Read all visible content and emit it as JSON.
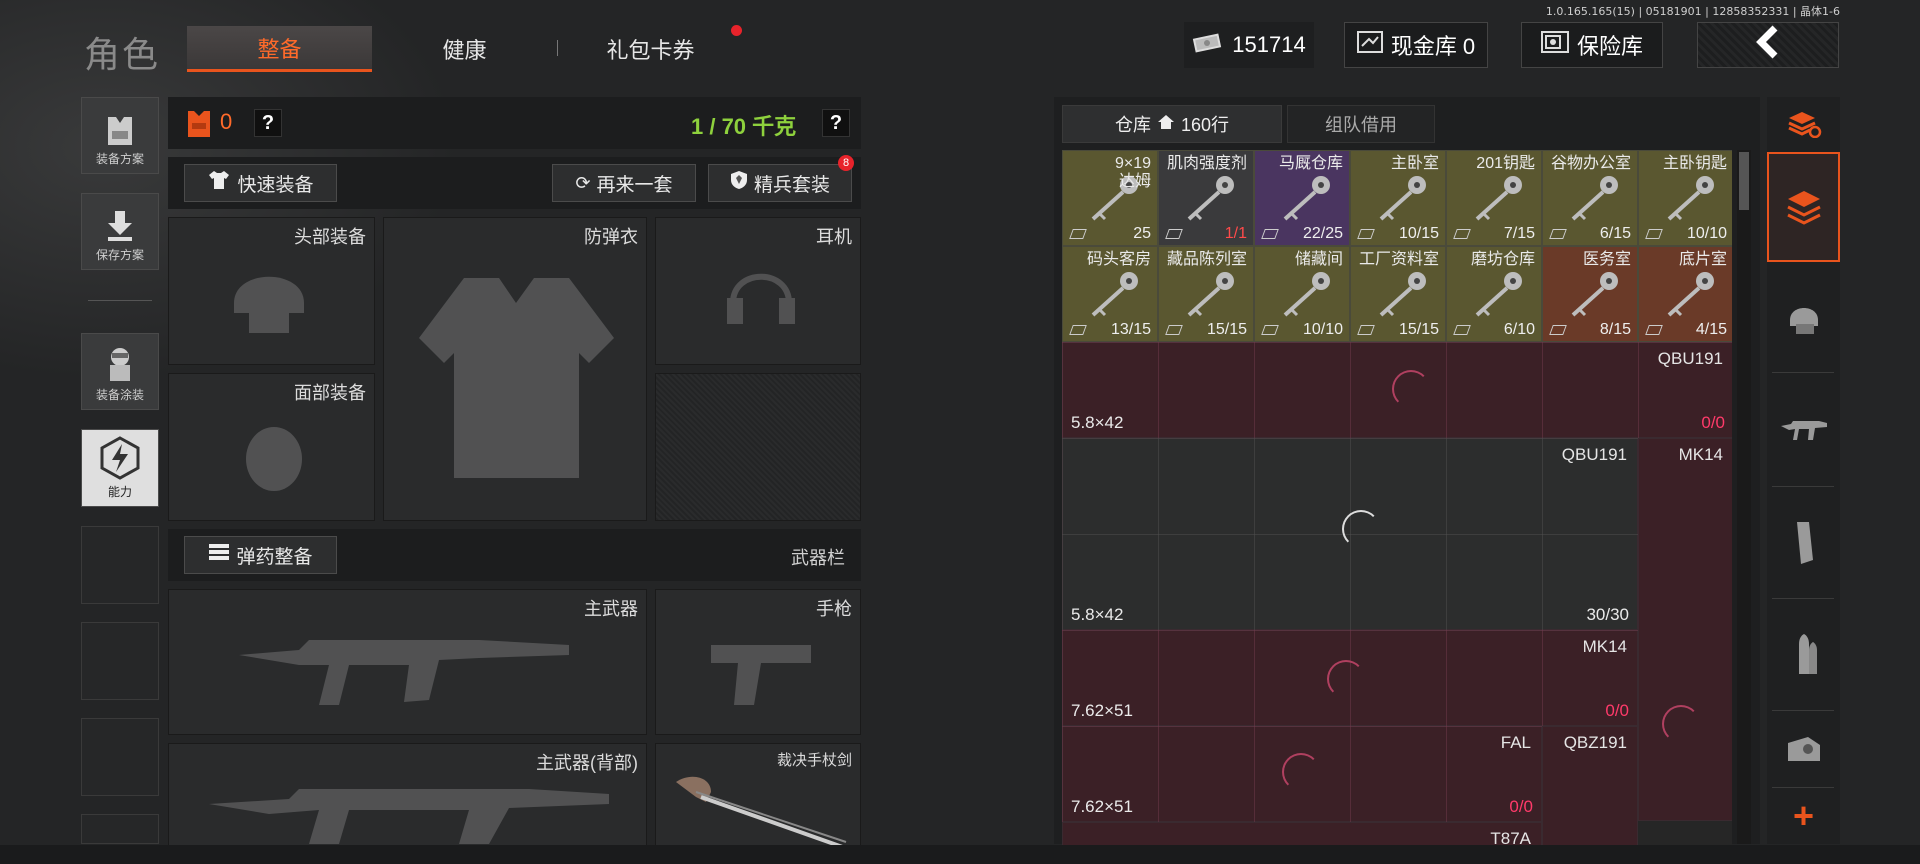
{
  "version": "1.0.165.165(15) | 05181901 | 12858352331 | 晶体1-6",
  "header": {
    "title": "角色",
    "tabs": [
      "整备",
      "健康",
      "礼包卡券"
    ],
    "money": "151714",
    "cash_storage": "现金库 0",
    "safe": "保险库"
  },
  "sidebar": [
    "装备方案",
    "保存方案",
    "装备涂装",
    "能力"
  ],
  "loadout": {
    "armor_value": "0",
    "weight": "1 / 70 千克",
    "quick_equip": "快速装备",
    "again": "再来一套",
    "elite": "精兵套装",
    "elite_badge": "8",
    "slots": {
      "head": "头部装备",
      "vest": "防弹衣",
      "ear": "耳机",
      "face": "面部装备"
    },
    "ammo_equip": "弹药整备",
    "weapon_bar": "武器栏",
    "primary": "主武器",
    "pistol": "手枪",
    "primary_back": "主武器(背部)",
    "melee": "裁决手杖剑"
  },
  "storage": {
    "tab_storage": "仓库",
    "rows": "160行",
    "tab_team": "组队借用",
    "items_row1": [
      {
        "name": "9×19\n达姆",
        "count": "25",
        "color": "#5a5730"
      },
      {
        "name": "肌肉强度剂",
        "count": "1/1",
        "color": "#3a3a3c",
        "count_color": "#ff4a4a"
      },
      {
        "name": "马厩仓库",
        "count": "22/25",
        "color": "#4a3560"
      },
      {
        "name": "主卧室",
        "count": "10/15",
        "color": "#5a5730"
      },
      {
        "name": "201钥匙",
        "count": "7/15",
        "color": "#5a5730"
      },
      {
        "name": "谷物办公室",
        "count": "6/15",
        "color": "#5a5730"
      },
      {
        "name": "主卧钥匙",
        "count": "10/10",
        "color": "#5a5730"
      }
    ],
    "items_row2": [
      {
        "name": "码头客房",
        "count": "13/15",
        "color": "#5a5730"
      },
      {
        "name": "藏品陈列室",
        "count": "15/15",
        "color": "#5a5730"
      },
      {
        "name": "储藏间",
        "count": "10/10",
        "color": "#5a5730"
      },
      {
        "name": "工厂资料室",
        "count": "15/15",
        "color": "#5a5730"
      },
      {
        "name": "磨坊仓库",
        "count": "6/10",
        "color": "#5a5730"
      },
      {
        "name": "医务室",
        "count": "8/15",
        "color": "#6a3a28"
      },
      {
        "name": "底片室",
        "count": "4/15",
        "color": "#6a3a28"
      }
    ],
    "weapons": [
      {
        "name": "QBU191",
        "cal": "5.8×42",
        "count": "0/0"
      },
      {
        "name": "QBU191",
        "cal": "5.8×42",
        "count": "30/30"
      },
      {
        "name": "MK14",
        "cal": "",
        "count": ""
      },
      {
        "name": "MK14",
        "cal": "7.62×51",
        "count": "0/0"
      },
      {
        "name": "FAL",
        "cal": "7.62×51",
        "count": "0/0"
      },
      {
        "name": "QBZ191",
        "cal": "",
        "count": ""
      },
      {
        "name": "T87A",
        "cal": "",
        "count": ""
      }
    ]
  }
}
